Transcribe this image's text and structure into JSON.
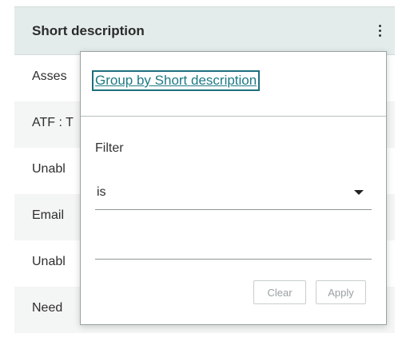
{
  "column": {
    "header_label": "Short description",
    "menu_icon": "more-vertical-icon",
    "rows": [
      {
        "text": "Asses"
      },
      {
        "text": "ATF : T"
      },
      {
        "text": "Unabl"
      },
      {
        "text": "Email"
      },
      {
        "text": "Unabl"
      },
      {
        "text": "Need"
      }
    ]
  },
  "popover": {
    "group_by_label": "Group by Short description",
    "filter_label": "Filter",
    "operator_value": "is",
    "operator_icon": "caret-down-icon",
    "value_input": "",
    "clear_label": "Clear",
    "apply_label": "Apply"
  },
  "colors": {
    "header_bg": "#e3ecea",
    "link": "#1f7a87",
    "alt_row_bg": "#f4f5f5"
  }
}
